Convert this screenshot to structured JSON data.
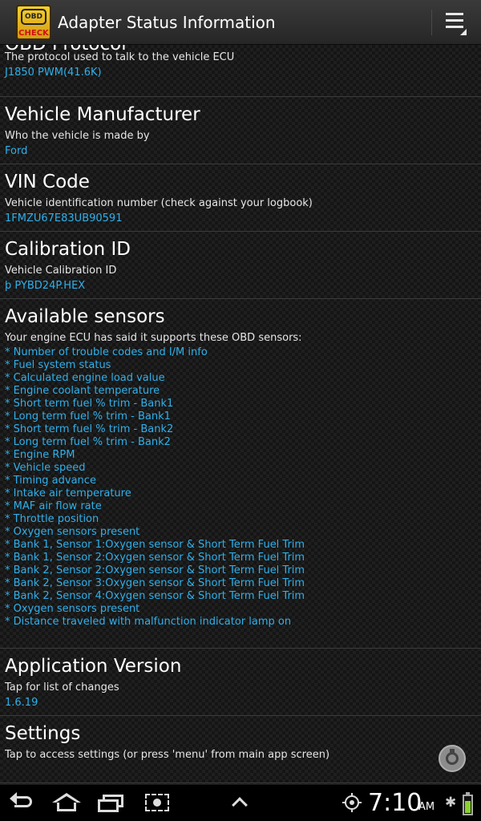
{
  "app": {
    "logo_top": "OBD",
    "logo_bottom": "CHECK",
    "title": "Adapter Status Information"
  },
  "sections": {
    "protocol": {
      "heading": "OBD Protocol",
      "description": "The protocol used to talk to the vehicle ECU",
      "value": "J1850 PWM(41.6K)"
    },
    "manufacturer": {
      "heading": "Vehicle Manufacturer",
      "description": "Who the vehicle is made by",
      "value": "Ford"
    },
    "vin": {
      "heading": "VIN Code",
      "description": "Vehicle identification number (check against your logbook)",
      "value": "1FMZU67E83UB90591"
    },
    "calibration": {
      "heading": "Calibration ID",
      "description": "Vehicle Calibration ID",
      "value": "þ PYBD24P.HEX"
    },
    "sensors": {
      "heading": "Available sensors",
      "description": "Your engine ECU has said it supports these OBD sensors:",
      "items": [
        "* Number of trouble codes and I/M info",
        "* Fuel system status",
        "* Calculated engine load value",
        "* Engine coolant temperature",
        "* Short term fuel % trim - Bank1",
        "* Long term fuel % trim - Bank1",
        "* Short term fuel % trim - Bank2",
        "* Long term fuel % trim - Bank2",
        "* Engine RPM",
        "* Vehicle speed",
        "* Timing advance",
        "* Intake air temperature",
        "* MAF air flow rate",
        "* Throttle position",
        "* Oxygen sensors present",
        "* Bank 1, Sensor 1:Oxygen sensor & Short Term Fuel Trim",
        "* Bank 1, Sensor 2:Oxygen sensor & Short Term Fuel Trim",
        "* Bank 2, Sensor 2:Oxygen sensor & Short Term Fuel Trim",
        "* Bank 2, Sensor 3:Oxygen sensor & Short Term Fuel Trim",
        "* Bank 2, Sensor 4:Oxygen sensor & Short Term Fuel Trim",
        "* Oxygen sensors present",
        "* Distance traveled with malfunction indicator lamp on"
      ]
    },
    "app_version": {
      "heading": "Application Version",
      "description": "Tap for list of changes",
      "value": "1.6.19"
    },
    "settings": {
      "heading": "Settings",
      "description": "Tap to access settings (or press 'menu' from main app screen)"
    }
  },
  "status": {
    "time": "7:10",
    "ampm": "AM",
    "battery_level": 0.7,
    "bluetooth_glyph": "✱"
  },
  "colors": {
    "value_text": "#2fb0ea",
    "battery_fill": "#8bd12c"
  },
  "icons": {
    "menu": "overflow-menu-icon",
    "fab": "gear-icon",
    "nav": [
      "back-icon",
      "home-icon",
      "recent-apps-icon",
      "screenshot-icon",
      "up-chevron-icon"
    ],
    "status": [
      "gps-icon",
      "bluetooth-icon",
      "battery-icon"
    ]
  }
}
